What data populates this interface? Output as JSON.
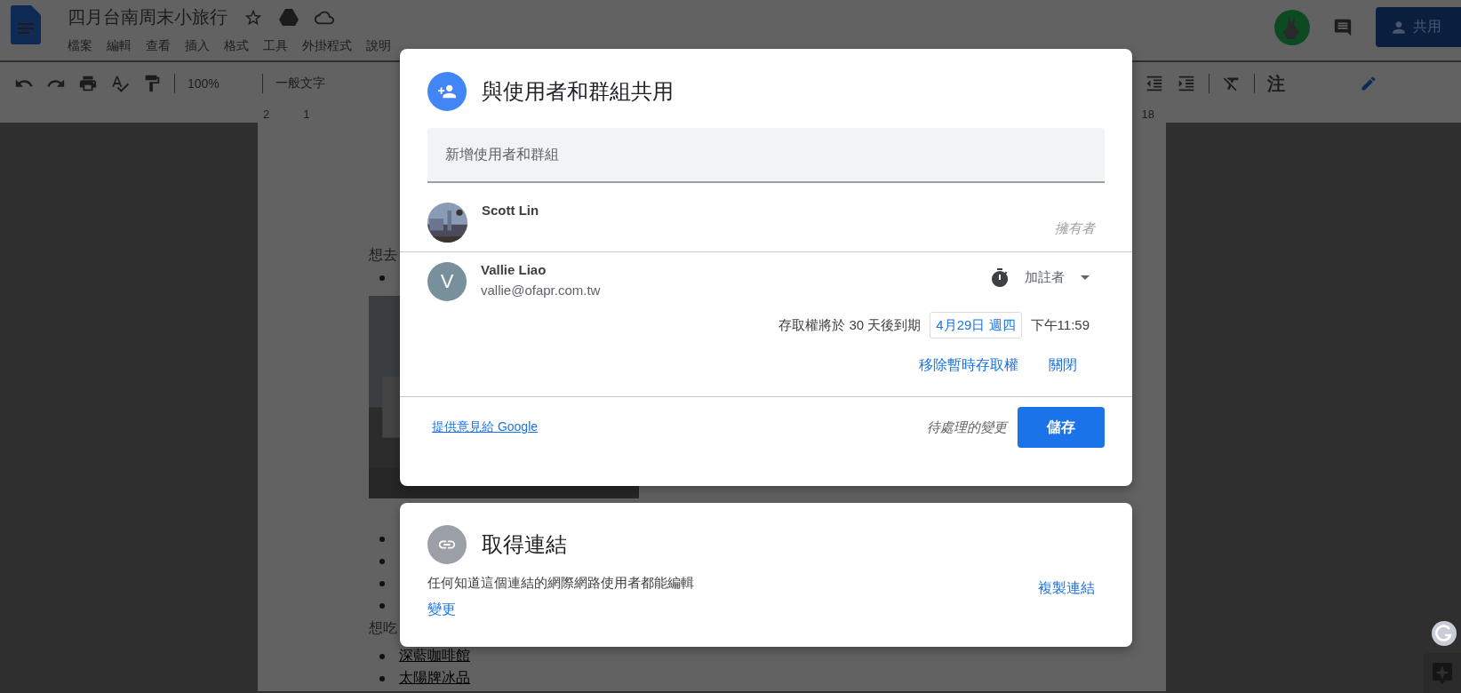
{
  "document": {
    "title": "四月台南周末小旅行",
    "menu": [
      "檔案",
      "編輯",
      "查看",
      "插入",
      "格式",
      "工具",
      "外掛程式",
      "說明"
    ],
    "toolbar": {
      "zoom": "100%",
      "style": "一般文字",
      "input_tool": "注"
    },
    "ruler": [
      "2",
      "1",
      "18"
    ],
    "share_button": "共用",
    "body": [
      {
        "kind": "heading",
        "text": "想去"
      },
      {
        "kind": "bullet"
      },
      {
        "kind": "picture"
      },
      {
        "kind": "bullet"
      },
      {
        "kind": "bullet"
      },
      {
        "kind": "bullet"
      },
      {
        "kind": "bullet"
      },
      {
        "kind": "heading",
        "text": "想吃"
      },
      {
        "kind": "link",
        "text": "深藍咖啡館"
      },
      {
        "kind": "link",
        "text": "太陽牌冰品"
      }
    ]
  },
  "share_dialog": {
    "title": "與使用者和群組共用",
    "add_field": {
      "placeholder": "新增使用者和群組"
    },
    "people": [
      {
        "kind": "owner",
        "name": "Scott Lin",
        "role": "擁有者"
      },
      {
        "kind": "member",
        "name": "Vallie Liao",
        "email": "vallie@ofapr.com.tw",
        "initial": "V",
        "role": "加註者",
        "expiry": {
          "text": "存取權將於 30 天後到期",
          "date": "4月29日 週四",
          "time": "下午11:59",
          "actions": [
            "移除暫時存取權",
            "關閉"
          ]
        }
      }
    ],
    "feedback_link": "提供意見給 Google",
    "pending": "待處理的變更",
    "save": "儲存"
  },
  "link_dialog": {
    "title": "取得連結",
    "description": "任何知道這個連結的網際網路使用者都能編輯",
    "change": "變更",
    "copy": "複製連結"
  }
}
